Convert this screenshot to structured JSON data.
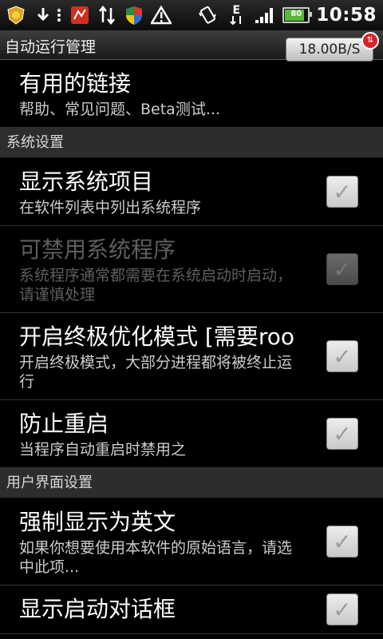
{
  "status_bar": {
    "time": "10:58",
    "battery_level": "80",
    "icons": [
      "app-notification-icon",
      "download-icon",
      "more-icon",
      "red-app-icon",
      "data-transfer-icon",
      "shield-icon",
      "warning-icon",
      "vibrate-icon",
      "edge-network-icon",
      "signal-icon",
      "battery-icon"
    ]
  },
  "header": {
    "title": "自动运行管理",
    "speed": "18.00B/S"
  },
  "items": [
    {
      "title": "有用的链接",
      "summary": "帮助、常见问题、Beta测试..."
    }
  ],
  "sections": [
    {
      "header": "系统设置",
      "items": [
        {
          "title": "显示系统项目",
          "summary": "在软件列表中列出系统程序",
          "checked": false,
          "enabled": true
        },
        {
          "title": "可禁用系统程序",
          "summary": "系统程序通常都需要在系统启动时启动，请谨慎处理",
          "checked": false,
          "enabled": false
        },
        {
          "title": "开启终极优化模式 [需要root]",
          "summary": "开启终极模式，大部分进程都将被终止运行",
          "checked": false,
          "enabled": true
        },
        {
          "title": "防止重启",
          "summary": "当程序自动重启时禁用之",
          "checked": false,
          "enabled": true
        }
      ]
    },
    {
      "header": "用户界面设置",
      "items": [
        {
          "title": "强制显示为英文",
          "summary": "如果你想要使用本软件的原始语言，请选中此项...",
          "checked": false,
          "enabled": true
        },
        {
          "title": "显示启动对话框",
          "summary": "",
          "checked": false,
          "enabled": true
        }
      ]
    }
  ]
}
